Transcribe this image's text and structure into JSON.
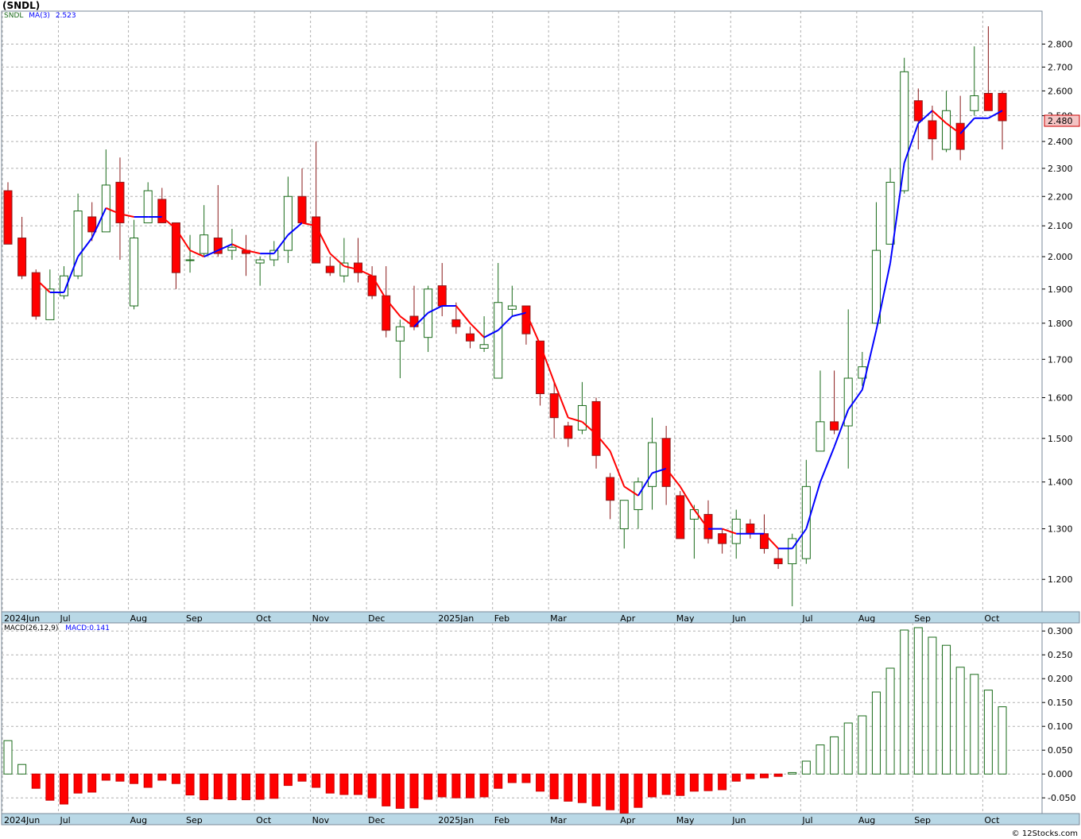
{
  "title": "(SNDL)",
  "credit": "© 12Stocks.com",
  "colors": {
    "up_candle": "#1a6b1a",
    "down_candle": "#ff0000",
    "ma_up": "#0000ff",
    "ma_down": "#ff0000",
    "grid": "#b0b0b0",
    "axis_strip": "#b9d8e6"
  },
  "chart_data": [
    {
      "type": "candlestick",
      "legend": {
        "symbol": "SNDL",
        "ma_label": "MA(3)",
        "ma_value": "2.523"
      },
      "last_price_label": "2.480",
      "y_scale": "log",
      "ylim": [
        1.14,
        2.95
      ],
      "yticks": [
        "2.800",
        "2.700",
        "2.600",
        "2.500",
        "2.400",
        "2.300",
        "2.200",
        "2.100",
        "2.000",
        "1.900",
        "1.800",
        "1.700",
        "1.600",
        "1.500",
        "1.400",
        "1.300",
        "1.200"
      ],
      "x_labels": [
        {
          "label": "2024Jun",
          "week": 0
        },
        {
          "label": "Jul",
          "week": 4
        },
        {
          "label": "Aug",
          "week": 9
        },
        {
          "label": "Sep",
          "week": 13
        },
        {
          "label": "Oct",
          "week": 18
        },
        {
          "label": "Nov",
          "week": 22
        },
        {
          "label": "Dec",
          "week": 26
        },
        {
          "label": "2025Jan",
          "week": 31
        },
        {
          "label": "Feb",
          "week": 35
        },
        {
          "label": "Mar",
          "week": 39
        },
        {
          "label": "Apr",
          "week": 44
        },
        {
          "label": "May",
          "week": 48
        },
        {
          "label": "Jun",
          "week": 52
        },
        {
          "label": "Jul",
          "week": 57
        },
        {
          "label": "Aug",
          "week": 61
        },
        {
          "label": "Sep",
          "week": 65
        },
        {
          "label": "Oct",
          "week": 70
        }
      ],
      "ohlc": [
        [
          2.22,
          2.25,
          2.04,
          2.04
        ],
        [
          2.06,
          2.13,
          1.93,
          1.94
        ],
        [
          1.95,
          1.96,
          1.81,
          1.82
        ],
        [
          1.81,
          1.96,
          1.81,
          1.9
        ],
        [
          1.88,
          1.97,
          1.87,
          1.94
        ],
        [
          1.94,
          2.21,
          1.93,
          2.15
        ],
        [
          2.13,
          2.18,
          2.05,
          2.08
        ],
        [
          2.08,
          2.37,
          2.08,
          2.24
        ],
        [
          2.25,
          2.34,
          1.99,
          2.11
        ],
        [
          1.85,
          2.12,
          1.84,
          2.06
        ],
        [
          2.11,
          2.25,
          2.11,
          2.22
        ],
        [
          2.19,
          2.23,
          2.11,
          2.11
        ],
        [
          2.11,
          2.11,
          1.9,
          1.95
        ],
        [
          1.99,
          2.07,
          1.95,
          1.99
        ],
        [
          2.01,
          2.17,
          2.0,
          2.07
        ],
        [
          2.06,
          2.24,
          2.0,
          2.01
        ],
        [
          2.02,
          2.09,
          1.99,
          2.03
        ],
        [
          2.02,
          2.07,
          1.94,
          2.01
        ],
        [
          1.98,
          2.0,
          1.91,
          1.99
        ],
        [
          1.99,
          2.05,
          1.97,
          2.02
        ],
        [
          2.02,
          2.27,
          1.98,
          2.2
        ],
        [
          2.2,
          2.3,
          2.12,
          2.11
        ],
        [
          2.13,
          2.4,
          1.99,
          1.98
        ],
        [
          1.97,
          2.0,
          1.94,
          1.95
        ],
        [
          1.94,
          2.06,
          1.92,
          1.98
        ],
        [
          1.98,
          2.06,
          1.92,
          1.95
        ],
        [
          1.94,
          1.97,
          1.87,
          1.88
        ],
        [
          1.88,
          1.97,
          1.76,
          1.78
        ],
        [
          1.75,
          1.81,
          1.65,
          1.79
        ],
        [
          1.82,
          1.91,
          1.78,
          1.79
        ],
        [
          1.76,
          1.91,
          1.72,
          1.9
        ],
        [
          1.91,
          1.98,
          1.82,
          1.85
        ],
        [
          1.81,
          1.86,
          1.77,
          1.79
        ],
        [
          1.77,
          1.79,
          1.73,
          1.75
        ],
        [
          1.73,
          1.82,
          1.72,
          1.74
        ],
        [
          1.65,
          1.98,
          1.65,
          1.86
        ],
        [
          1.84,
          1.91,
          1.82,
          1.85
        ],
        [
          1.85,
          1.85,
          1.74,
          1.77
        ],
        [
          1.75,
          1.75,
          1.58,
          1.61
        ],
        [
          1.61,
          1.64,
          1.5,
          1.55
        ],
        [
          1.53,
          1.54,
          1.48,
          1.5
        ],
        [
          1.52,
          1.64,
          1.51,
          1.58
        ],
        [
          1.59,
          1.6,
          1.43,
          1.46
        ],
        [
          1.41,
          1.42,
          1.32,
          1.36
        ],
        [
          1.3,
          1.36,
          1.26,
          1.36
        ],
        [
          1.34,
          1.41,
          1.3,
          1.4
        ],
        [
          1.39,
          1.55,
          1.34,
          1.49
        ],
        [
          1.5,
          1.53,
          1.35,
          1.39
        ],
        [
          1.37,
          1.38,
          1.28,
          1.28
        ],
        [
          1.32,
          1.35,
          1.24,
          1.34
        ],
        [
          1.33,
          1.36,
          1.27,
          1.28
        ],
        [
          1.29,
          1.3,
          1.25,
          1.27
        ],
        [
          1.27,
          1.34,
          1.24,
          1.32
        ],
        [
          1.31,
          1.32,
          1.28,
          1.29
        ],
        [
          1.29,
          1.33,
          1.25,
          1.26
        ],
        [
          1.24,
          1.26,
          1.22,
          1.23
        ],
        [
          1.23,
          1.29,
          1.15,
          1.28
        ],
        [
          1.24,
          1.45,
          1.23,
          1.39
        ],
        [
          1.47,
          1.67,
          1.47,
          1.54
        ],
        [
          1.54,
          1.67,
          1.51,
          1.52
        ],
        [
          1.53,
          1.84,
          1.43,
          1.65
        ],
        [
          1.65,
          1.72,
          1.63,
          1.68
        ],
        [
          1.8,
          2.18,
          1.8,
          2.02
        ],
        [
          2.04,
          2.3,
          2.04,
          2.25
        ],
        [
          2.22,
          2.74,
          2.21,
          2.68
        ],
        [
          2.56,
          2.61,
          2.37,
          2.48
        ],
        [
          2.48,
          2.54,
          2.33,
          2.41
        ],
        [
          2.37,
          2.6,
          2.36,
          2.52
        ],
        [
          2.47,
          2.58,
          2.33,
          2.37
        ],
        [
          2.52,
          2.79,
          2.5,
          2.58
        ],
        [
          2.59,
          2.88,
          2.52,
          2.52
        ],
        [
          2.59,
          2.6,
          2.37,
          2.48
        ]
      ],
      "ma3": [
        null,
        null,
        1.93,
        1.89,
        1.89,
        2.0,
        2.06,
        2.16,
        2.14,
        2.13,
        2.13,
        2.13,
        2.09,
        2.02,
        2.0,
        2.02,
        2.04,
        2.02,
        2.01,
        2.01,
        2.07,
        2.11,
        2.1,
        2.01,
        1.97,
        1.96,
        1.94,
        1.87,
        1.82,
        1.79,
        1.83,
        1.85,
        1.85,
        1.8,
        1.76,
        1.78,
        1.82,
        1.83,
        1.74,
        1.64,
        1.55,
        1.54,
        1.51,
        1.47,
        1.39,
        1.37,
        1.42,
        1.43,
        1.39,
        1.34,
        1.3,
        1.3,
        1.29,
        1.29,
        1.29,
        1.26,
        1.26,
        1.3,
        1.4,
        1.48,
        1.57,
        1.62,
        1.78,
        1.98,
        2.32,
        2.47,
        2.52,
        2.47,
        2.43,
        2.49,
        2.49,
        2.52
      ]
    },
    {
      "type": "bar",
      "legend": {
        "label": "MACD(26,12,9)",
        "value_label": "MACD:0.141"
      },
      "ylim": [
        -0.083,
        0.317
      ],
      "yticks": [
        "0.300",
        "0.250",
        "0.200",
        "0.150",
        "0.100",
        "0.050",
        "0.000",
        "-0.050"
      ],
      "values": [
        0.07,
        0.02,
        -0.03,
        -0.055,
        -0.063,
        -0.04,
        -0.038,
        -0.013,
        -0.015,
        -0.02,
        -0.028,
        -0.013,
        -0.02,
        -0.044,
        -0.054,
        -0.052,
        -0.054,
        -0.054,
        -0.053,
        -0.051,
        -0.024,
        -0.015,
        -0.028,
        -0.04,
        -0.043,
        -0.043,
        -0.05,
        -0.067,
        -0.072,
        -0.071,
        -0.053,
        -0.048,
        -0.05,
        -0.05,
        -0.048,
        -0.03,
        -0.018,
        -0.018,
        -0.036,
        -0.052,
        -0.057,
        -0.06,
        -0.067,
        -0.075,
        -0.082,
        -0.07,
        -0.048,
        -0.043,
        -0.045,
        -0.036,
        -0.035,
        -0.033,
        -0.015,
        -0.01,
        -0.008,
        -0.005,
        0.003,
        0.027,
        0.061,
        0.078,
        0.107,
        0.122,
        0.172,
        0.222,
        0.302,
        0.307,
        0.287,
        0.27,
        0.224,
        0.209,
        0.176,
        0.141
      ]
    }
  ]
}
